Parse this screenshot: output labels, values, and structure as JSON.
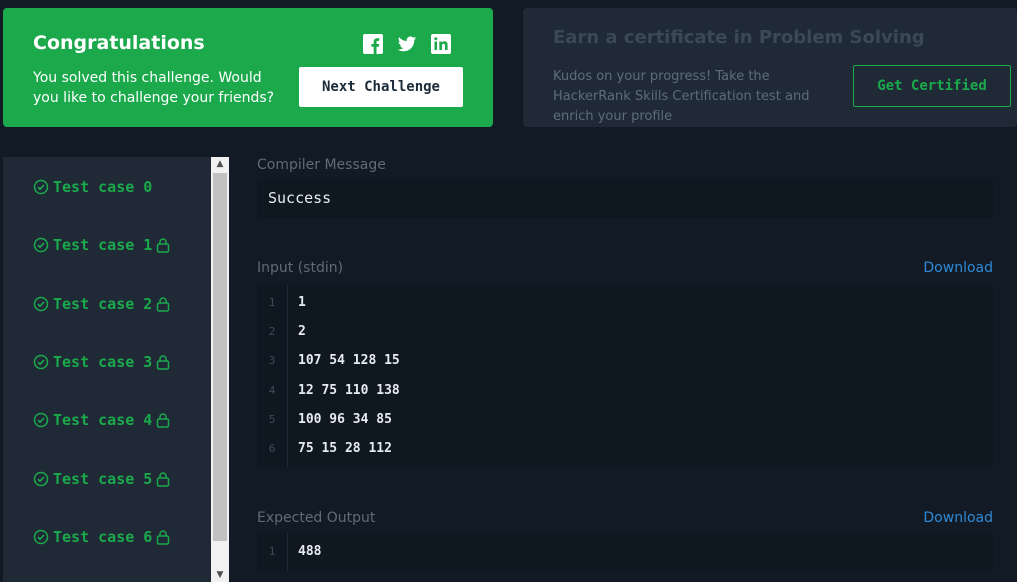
{
  "congrats": {
    "title": "Congratulations",
    "description": "You solved this challenge. Would you like to challenge your friends?",
    "next_button": "Next Challenge",
    "social": [
      "facebook-icon",
      "twitter-icon",
      "linkedin-icon"
    ],
    "bg_color": "#1ba94c"
  },
  "certificate": {
    "title": "Earn a certificate in Problem Solving",
    "description": "Kudos on your progress! Take the HackerRank Skills Certification test and enrich your profile",
    "button": "Get Certified"
  },
  "test_cases": [
    {
      "label": "Test case 0",
      "locked": false
    },
    {
      "label": "Test case 1",
      "locked": true
    },
    {
      "label": "Test case 2",
      "locked": true
    },
    {
      "label": "Test case 3",
      "locked": true
    },
    {
      "label": "Test case 4",
      "locked": true
    },
    {
      "label": "Test case 5",
      "locked": true
    },
    {
      "label": "Test case 6",
      "locked": true
    }
  ],
  "compiler": {
    "label": "Compiler Message",
    "message": "Success"
  },
  "input": {
    "label": "Input (stdin)",
    "download": "Download",
    "lines": [
      {
        "n": "1",
        "text": "1"
      },
      {
        "n": "2",
        "text": "2"
      },
      {
        "n": "3",
        "text": "107 54 128 15"
      },
      {
        "n": "4",
        "text": "12 75 110 138"
      },
      {
        "n": "5",
        "text": "100 96 34 85"
      },
      {
        "n": "6",
        "text": "75 15 28 112"
      }
    ]
  },
  "expected": {
    "label": "Expected Output",
    "download": "Download",
    "lines": [
      {
        "n": "1",
        "text": "488"
      }
    ]
  },
  "colors": {
    "accent": "#1ba94c",
    "link": "#2f89d6",
    "background": "#121b25"
  }
}
